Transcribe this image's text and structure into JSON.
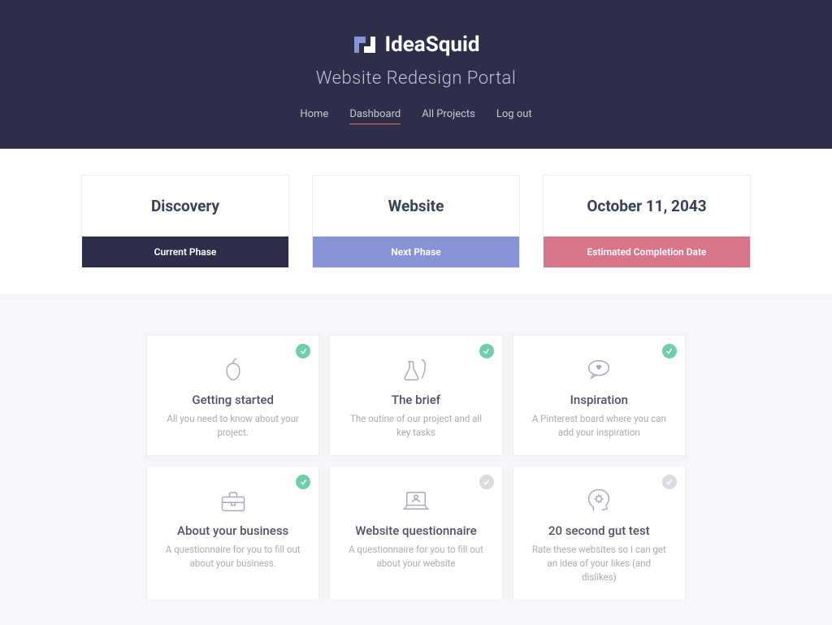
{
  "brand": "IdeaSquid",
  "subtitle": "Website Redesign Portal",
  "nav": [
    {
      "label": "Home",
      "active": false
    },
    {
      "label": "Dashboard",
      "active": true
    },
    {
      "label": "All Projects",
      "active": false
    },
    {
      "label": "Log out",
      "active": false
    }
  ],
  "status": [
    {
      "value": "Discovery",
      "label": "Current Phase",
      "styleClass": "dark"
    },
    {
      "value": "Website",
      "label": "Next Phase",
      "styleClass": "blue"
    },
    {
      "value": "October 11, 2043",
      "label": "Estimated Completion Date",
      "styleClass": "pink"
    }
  ],
  "tasks": [
    {
      "title": "Getting started",
      "desc": "All you need to know about your project.",
      "done": true,
      "icon": "apple-icon"
    },
    {
      "title": "The brief",
      "desc": "The outine of our project and all key tasks",
      "done": true,
      "icon": "flask-leaf-icon"
    },
    {
      "title": "Inspiration",
      "desc": "A Pinterest board where you can add your inspiration",
      "done": true,
      "icon": "heart-bubble-icon"
    },
    {
      "title": "About your business",
      "desc": "A questionnaire for you to fill out about your business.",
      "done": true,
      "icon": "briefcase-icon"
    },
    {
      "title": "Website questionnaire",
      "desc": "A questionnaire for you to fill out about your website",
      "done": false,
      "icon": "laptop-user-icon"
    },
    {
      "title": "20 second gut test",
      "desc": "Rate these websites so I can get an idea of your likes (and dislikes)",
      "done": false,
      "icon": "head-gear-icon"
    }
  ]
}
